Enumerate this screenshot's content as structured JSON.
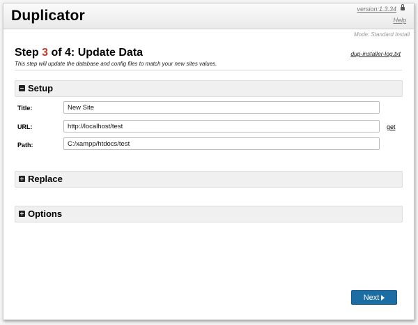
{
  "header": {
    "app_title": "Duplicator",
    "version": "version:1.3.34",
    "help": "Help"
  },
  "mode": "Mode: Standard Install",
  "step": {
    "prefix": "Step ",
    "number": "3",
    "suffix": " of 4: Update Data",
    "description": "This step will update the database and config files to match your new sites values.",
    "log_link": "dup-installer-log.txt"
  },
  "sections": {
    "setup": {
      "label": "Setup",
      "state": "expanded"
    },
    "replace": {
      "label": "Replace",
      "state": "collapsed"
    },
    "options": {
      "label": "Options",
      "state": "collapsed"
    }
  },
  "fields": {
    "title": {
      "label": "Title:",
      "value": "New Site"
    },
    "url": {
      "label": "URL:",
      "value": "http://localhost/test",
      "action": "get"
    },
    "path": {
      "label": "Path:",
      "value": "C:/xampp/htdocs/test"
    }
  },
  "next_label": "Next",
  "colors": {
    "step_number": "#c0392b",
    "next_button": "#1c6da4"
  },
  "icons": {
    "lock": "lock-icon",
    "collapse": "minus-square-icon",
    "expand": "plus-square-icon",
    "next": "caret-right-icon"
  }
}
